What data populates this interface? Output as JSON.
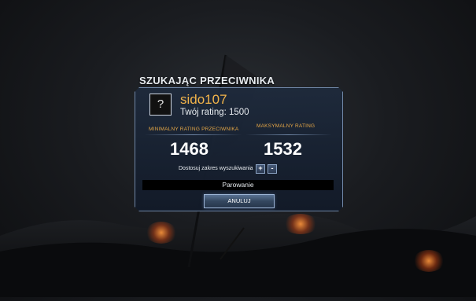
{
  "dialog": {
    "title": "SZUKAJĄC PRZECIWNIKA",
    "player": {
      "avatar_glyph": "?",
      "name": "sido107",
      "rating_text": "Twój rating: 1500"
    },
    "min_rating": {
      "label": "MINIMALNY RATING PRZECIWNIKA",
      "value": "1468"
    },
    "max_rating": {
      "label": "MAKSYMALNY RATING",
      "value": "1532"
    },
    "adjust": {
      "label": "Dostosuj zakres wyszukiwania",
      "plus": "+",
      "minus": "-"
    },
    "status": "Parowanie",
    "cancel_label": "ANULUJ"
  },
  "colors": {
    "accent": "#e5a746",
    "player_name": "#f2b44a",
    "panel_border": "#6f86a6"
  }
}
